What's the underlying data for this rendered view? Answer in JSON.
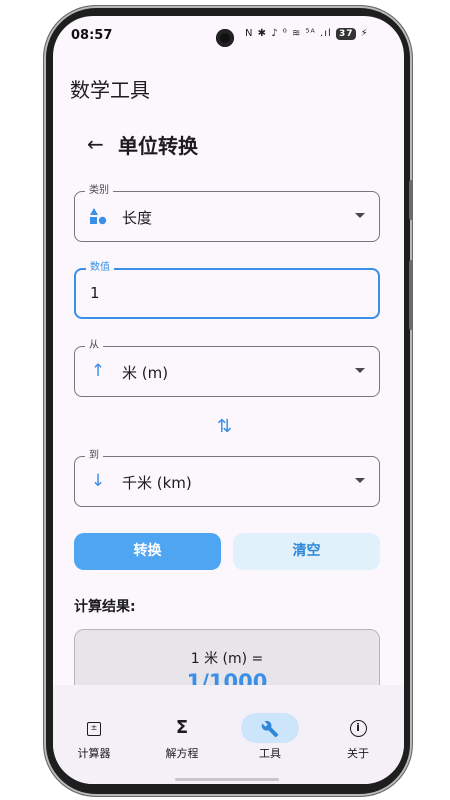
{
  "status_bar": {
    "time": "08:57",
    "icons": "N ✱ ♪ ⁰ ≋ ⁵ᴬ .ıl",
    "battery": "37"
  },
  "app": {
    "title": "数学工具"
  },
  "page": {
    "title": "单位转换",
    "back_icon": "arrow-left-icon"
  },
  "form": {
    "category": {
      "label": "类别",
      "value": "长度",
      "icon": "shapes-icon"
    },
    "number": {
      "label": "数值",
      "value": "1"
    },
    "from": {
      "label": "从",
      "value": "米 (m)",
      "icon": "arrow-up-icon"
    },
    "to": {
      "label": "到",
      "value": "千米 (km)",
      "icon": "arrow-down-icon"
    },
    "swap_icon": "swap-vertical-icon"
  },
  "buttons": {
    "convert": "转换",
    "clear": "清空"
  },
  "result": {
    "label": "计算结果:",
    "expression": "1 米 (m) =",
    "value": "1/1000"
  },
  "nav": [
    {
      "label": "计算器",
      "icon": "calculator-icon"
    },
    {
      "label": "解方程",
      "icon": "sigma-icon"
    },
    {
      "label": "工具",
      "icon": "wrench-icon",
      "active": true
    },
    {
      "label": "关于",
      "icon": "info-icon"
    }
  ],
  "colors": {
    "accent": "#3a8fe6",
    "primary_button": "#4ea6f2",
    "background": "#fcf7fd"
  }
}
